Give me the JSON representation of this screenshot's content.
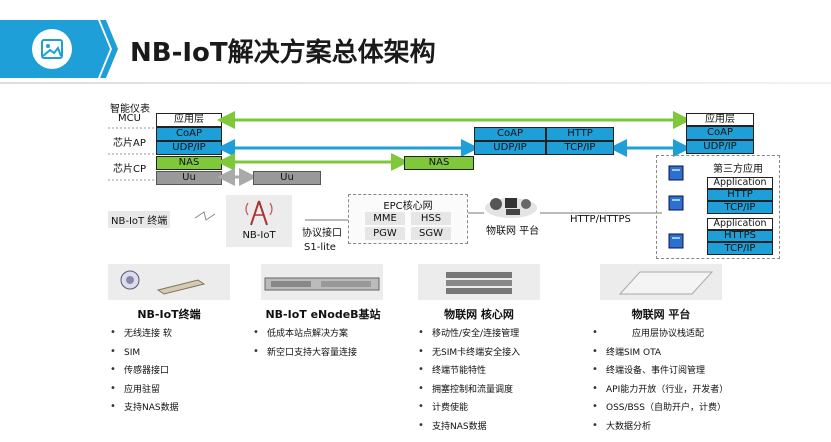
{
  "page": {
    "title": "NB-IoT解决方案总体架构"
  },
  "diagram": {
    "row_labels": {
      "meter": "智能仪表",
      "mcu": "MCU",
      "chip_ap": "芯片AP",
      "chip_cp": "芯片CP",
      "terminal": "NB-IoT 终端"
    },
    "left_stack": [
      "应用层",
      "CoAP",
      "UDP/IP",
      "NAS",
      "Uu"
    ],
    "mid_boxes": {
      "nas": "NAS",
      "uu": "Uu",
      "coap": "CoAP",
      "udp": "UDP/IP",
      "http": "HTTP",
      "tcp": "TCP/IP"
    },
    "right_stack": [
      "应用层",
      "CoAP",
      "UDP/IP"
    ],
    "enodeb": {
      "label": "NB-IoT",
      "iface_top": "协议接口",
      "iface_bottom": "S1-lite"
    },
    "epc": {
      "title": "EPC核心网",
      "cells": [
        "MME",
        "HSS",
        "PGW",
        "SGW"
      ]
    },
    "iot_platform": "物联网 平台",
    "http_link": "HTTP/HTTPS",
    "third_party": {
      "title": "第三方应用",
      "app1": [
        "Application",
        "HTTP",
        "TCP/IP"
      ],
      "app2": [
        "Application",
        "HTTPS",
        "TCP/IP"
      ]
    }
  },
  "sections": [
    {
      "title": "NB-IoT终端",
      "items": [
        "无线连接 软",
        "SIM",
        "传感器接口",
        "应用驻留",
        "支持NAS数据"
      ]
    },
    {
      "title": "NB-IoT eNodeB基站",
      "items": [
        "低成本站点解决方案",
        "新空口支持大容量连接"
      ]
    },
    {
      "title": "物联网 核心网",
      "items": [
        "移动性/安全/连接管理",
        "无SIM卡终端安全接入",
        "终端节能特性",
        "拥塞控制和流量调度",
        "计费使能",
        "支持NAS数据"
      ]
    },
    {
      "title": "物联网 平台",
      "items": [
        "应用层协议栈适配",
        "终端SIM OTA",
        "终端设备、事件订阅管理",
        "API能力开放（行业，开发者）",
        "OSS/BSS（自助开户，计费）",
        "大数据分析"
      ]
    }
  ],
  "colors": {
    "banner": "#1e9fd8",
    "blue_box": "#1e9fd8",
    "green_box": "#7ec83a",
    "grey_box": "#999999"
  }
}
